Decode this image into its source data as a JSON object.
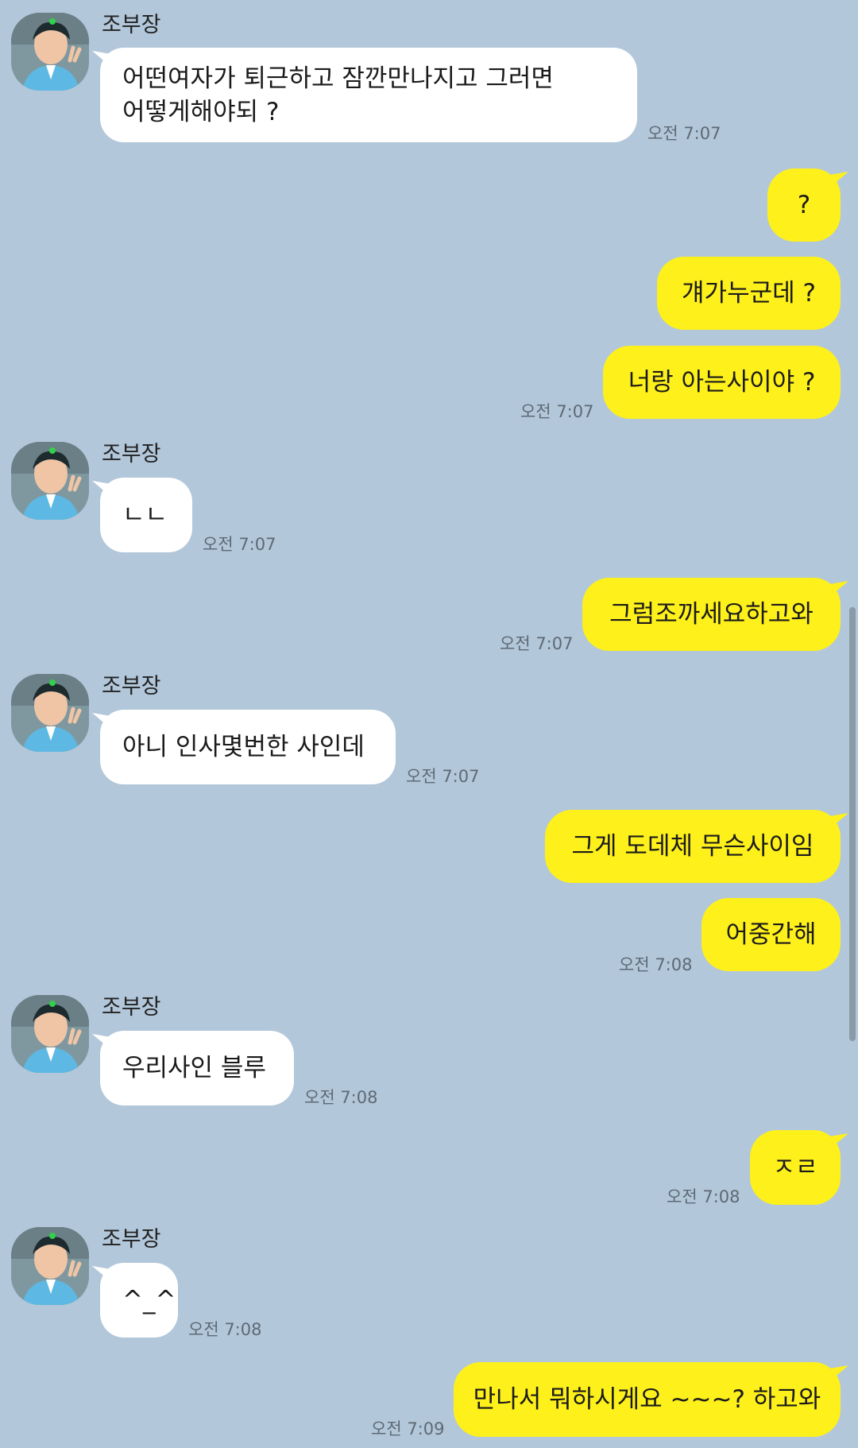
{
  "colors": {
    "background": "#b2c7da",
    "incoming_bubble": "#ffffff",
    "outgoing_bubble": "#fef01b"
  },
  "sender": "조부장",
  "messages": [
    {
      "text": "어떤여자가 퇴근하고 잠깐만나지고 그러면\n어떻게해야되 ?",
      "time": "오전 7:07"
    },
    {
      "text": "?"
    },
    {
      "text": "걔가누군데 ?"
    },
    {
      "text": "너랑 아는사이야 ?",
      "time": "오전 7:07"
    },
    {
      "text": "ㄴㄴ",
      "time": "오전 7:07"
    },
    {
      "text": "그럼조까세요하고와",
      "time": "오전 7:07"
    },
    {
      "text": "아니 인사몇번한 사인데",
      "time": "오전 7:07"
    },
    {
      "text": "그게 도데체 무슨사이임"
    },
    {
      "text": "어중간해",
      "time": "오전 7:08"
    },
    {
      "text": "우리사인 블루",
      "time": "오전 7:08"
    },
    {
      "text": "ㅈㄹ",
      "time": "오전 7:08"
    },
    {
      "text": "^_^",
      "time": "오전 7:08"
    },
    {
      "text": "만나서 뭐하시게요 ~~~? 하고와",
      "time": "오전 7:09"
    }
  ]
}
